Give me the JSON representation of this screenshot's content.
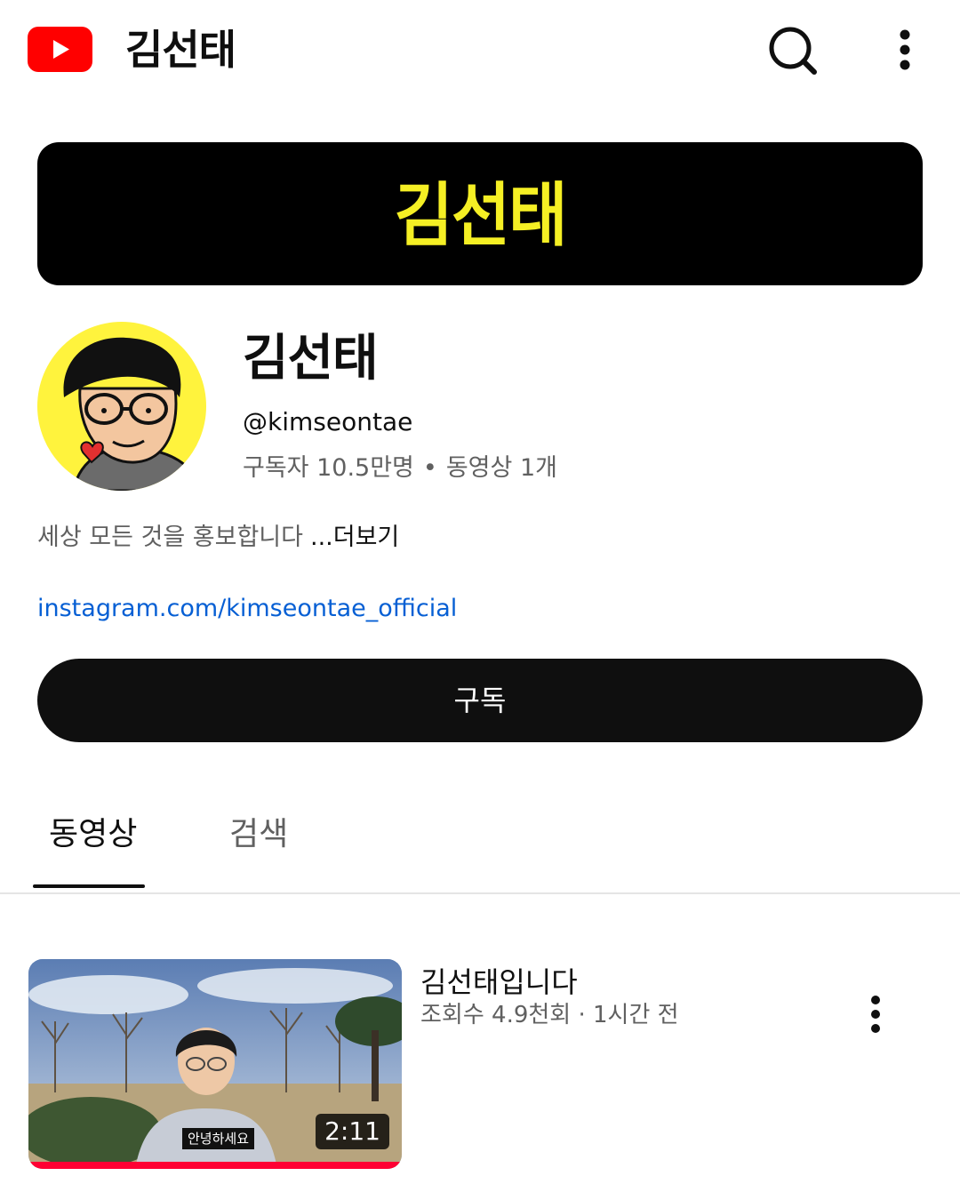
{
  "appbar": {
    "title": "김선태",
    "logo_icon": "youtube-play-icon",
    "search_icon": "search-icon",
    "more_icon": "more-vertical-icon"
  },
  "banner": {
    "text": "김선태",
    "text_color": "#f5ef24",
    "background": "#000000"
  },
  "channel": {
    "name": "김선태",
    "handle": "@kimseontae",
    "subscribers": "구독자 10.5만명",
    "separator": "•",
    "video_count": "동영상 1개",
    "description": "세상 모든 것을 홍보합니다",
    "more_label": "...더보기",
    "link": "instagram.com/kimseontae_official",
    "subscribe_label": "구독"
  },
  "tabs": [
    {
      "label": "동영상",
      "selected": true
    },
    {
      "label": "검색",
      "selected": false
    }
  ],
  "videos": [
    {
      "title": "김선태입니다",
      "meta": "조회수 4.9천회 · 1시간 전",
      "duration": "2:11",
      "caption": "안녕하세요",
      "watched_fraction": 1.0,
      "more_icon": "more-vertical-icon"
    }
  ],
  "colors": {
    "youtube_red": "#ff0000",
    "link_blue": "#065fd4",
    "secondary_text": "#606060",
    "avatar_background": "#fff33d"
  }
}
